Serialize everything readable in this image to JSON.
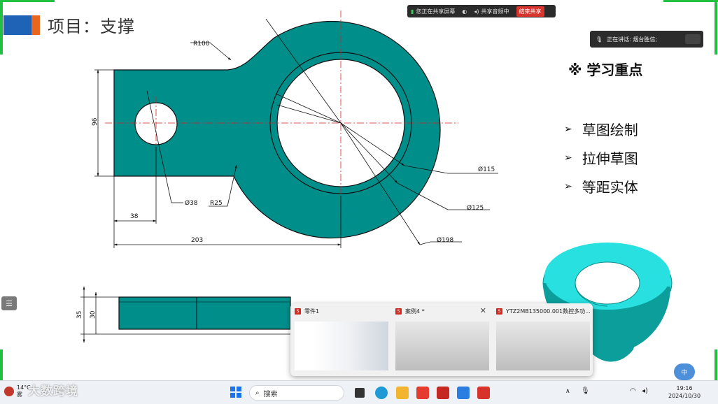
{
  "slide": {
    "title": "项目：支撑",
    "key_points_title": "※ 学习重点",
    "key_points": [
      "草图绘制",
      "拉伸草图",
      "等距实体"
    ],
    "arrow_glyph": "➢"
  },
  "drawing": {
    "dims": {
      "r100": "R100",
      "d96": "96",
      "d115": "Ø115",
      "d125": "Ø125",
      "d198": "Ø198",
      "d38_hole": "Ø38",
      "r25": "R25",
      "d38": "38",
      "d203": "203",
      "d35": "35",
      "d30": "30"
    },
    "colors": {
      "fill": "#008e8a",
      "line": "#111111",
      "center": "#d62020",
      "iso_light": "#28e0e0"
    }
  },
  "share_toolbar": {
    "sharing_label": "您正在共享屏幕",
    "audio_label": "共享音频中",
    "stop_label": "结束共享"
  },
  "speaking_panel": {
    "label": "正在讲话: 烟台胜信;"
  },
  "taskbar_previews": [
    {
      "title": "零件1"
    },
    {
      "title": "案例4 *"
    },
    {
      "title": "YTZ2MB135000.001数控多功..."
    }
  ],
  "taskbar": {
    "weather_temp": "14°C",
    "weather_desc": "雾",
    "watermark": "大数跨境",
    "search_placeholder": "搜索",
    "ime_label": "中",
    "time": "19:16",
    "date": "2024/10/30"
  }
}
